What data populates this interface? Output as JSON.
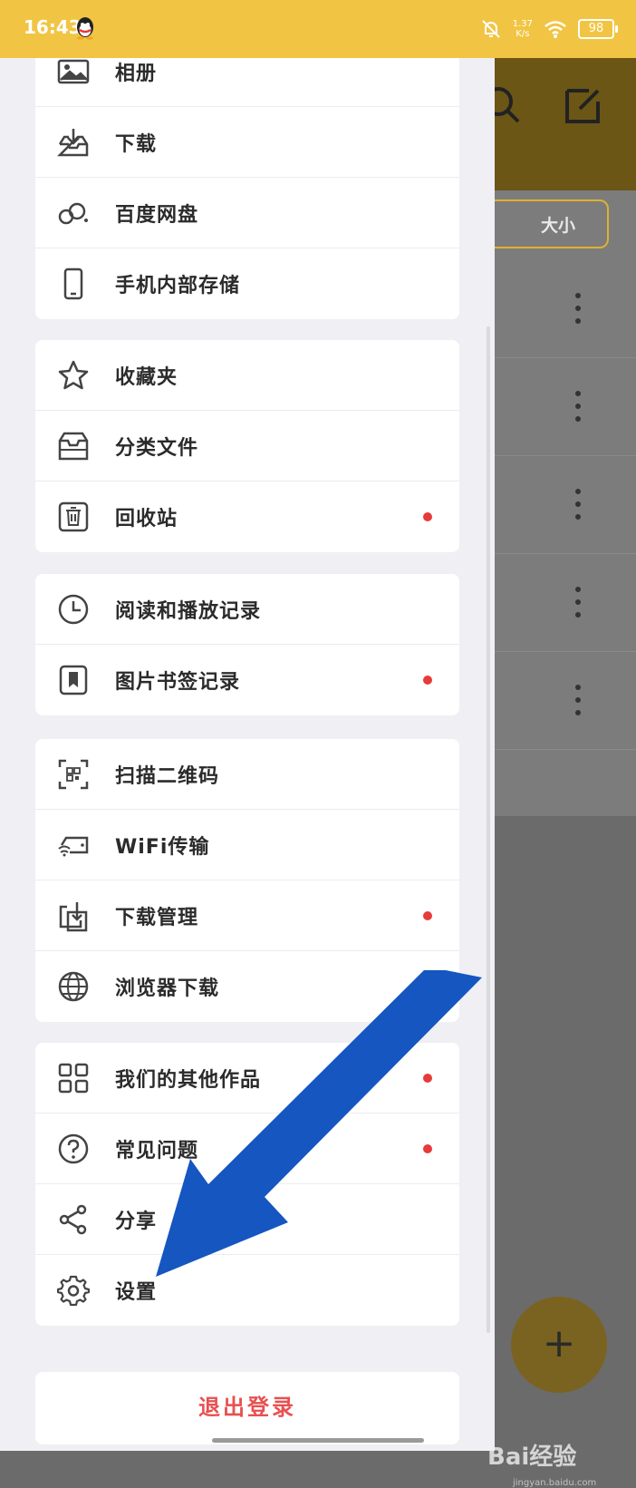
{
  "status_bar": {
    "time": "16:43",
    "speed_value": "1.37",
    "speed_unit": "K/s",
    "battery": "98"
  },
  "background_app": {
    "sort_button": "大小"
  },
  "drawer": {
    "groups": [
      {
        "items": [
          {
            "label": "相册",
            "icon": "photo-album-icon",
            "dot": false
          },
          {
            "label": "下载",
            "icon": "download-tray-icon",
            "dot": false
          },
          {
            "label": "百度网盘",
            "icon": "baidu-netdisk-icon",
            "dot": false
          },
          {
            "label": "手机内部存储",
            "icon": "phone-storage-icon",
            "dot": false
          }
        ]
      },
      {
        "items": [
          {
            "label": "收藏夹",
            "icon": "star-icon",
            "dot": false
          },
          {
            "label": "分类文件",
            "icon": "inbox-icon",
            "dot": false
          },
          {
            "label": "回收站",
            "icon": "trash-icon",
            "dot": true
          }
        ]
      },
      {
        "items": [
          {
            "label": "阅读和播放记录",
            "icon": "clock-icon",
            "dot": false
          },
          {
            "label": "图片书签记录",
            "icon": "bookmark-icon",
            "dot": true
          }
        ]
      },
      {
        "items": [
          {
            "label": "扫描二维码",
            "icon": "qr-scan-icon",
            "dot": false
          },
          {
            "label": "WiFi传输",
            "icon": "wifi-transfer-icon",
            "dot": false
          },
          {
            "label": "下载管理",
            "icon": "download-manage-icon",
            "dot": true
          },
          {
            "label": "浏览器下载",
            "icon": "globe-icon",
            "dot": false
          }
        ]
      },
      {
        "items": [
          {
            "label": "我们的其他作品",
            "icon": "grid-apps-icon",
            "dot": true
          },
          {
            "label": "常见问题",
            "icon": "question-icon",
            "dot": true
          },
          {
            "label": "分享",
            "icon": "share-icon",
            "dot": false
          },
          {
            "label": "设置",
            "icon": "gear-icon",
            "dot": false
          }
        ]
      }
    ],
    "logout_label": "退出登录"
  },
  "watermark": {
    "text": "Bai经验",
    "sub": "jingyan.baidu.com"
  },
  "fab_label": "+",
  "colors": {
    "status_bar": "#f1c543",
    "dot": "#e83a3a",
    "logout": "#e85050",
    "arrow": "#1556c0"
  }
}
